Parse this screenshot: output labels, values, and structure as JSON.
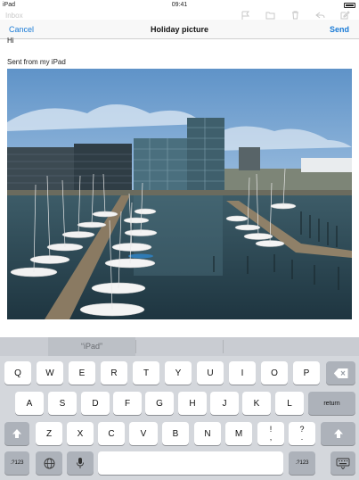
{
  "status_bar": {
    "carrier": "iPad",
    "time": "09:41"
  },
  "background_toolbar": {
    "back_label": "Inbox",
    "icons": [
      "flag-icon",
      "folder-icon",
      "trash-icon",
      "reply-icon",
      "compose-icon"
    ]
  },
  "compose": {
    "cancel_label": "Cancel",
    "title": "Holiday picture",
    "send_label": "Send",
    "body_text": "Hi",
    "signature": "Sent from my iPad",
    "attachment_icon": "photo-icon"
  },
  "keyboard": {
    "predictions": [
      "“iPad”",
      "",
      ""
    ],
    "rows": [
      [
        "Q",
        "W",
        "E",
        "R",
        "T",
        "Y",
        "U",
        "I",
        "O",
        "P"
      ],
      [
        "A",
        "S",
        "D",
        "F",
        "G",
        "H",
        "J",
        "K",
        "L"
      ],
      [
        "Z",
        "X",
        "C",
        "V",
        "B",
        "N",
        "M"
      ]
    ],
    "punct_keys": [
      {
        "top": "!",
        "bottom": ","
      },
      {
        "top": "?",
        "bottom": "."
      }
    ],
    "return_label": "return",
    "numbers_label": ".?123",
    "icons": [
      "backspace-icon",
      "shift-icon",
      "globe-icon",
      "microphone-icon",
      "keyboard-hide-icon"
    ],
    "space_label": ""
  }
}
